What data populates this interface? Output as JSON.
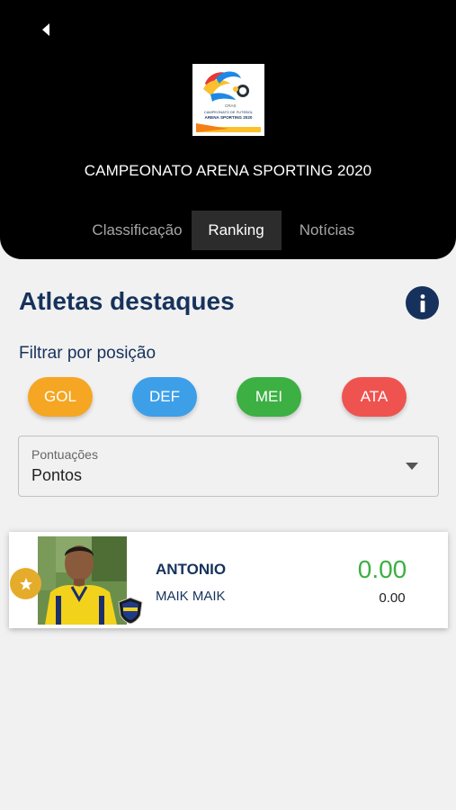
{
  "header": {
    "title": "CAMPEONATO ARENA SPORTING 2020",
    "logo": {
      "org": "CRAS",
      "line1": "CAMPEONATO DE FUTEBOL",
      "line2": "ARENA SPORTING 2020"
    },
    "tabs": [
      {
        "label": "Classificação",
        "active": false
      },
      {
        "label": "Ranking",
        "active": true
      },
      {
        "label": "Notícias",
        "active": false
      }
    ]
  },
  "main": {
    "title": "Atletas destaques",
    "filter_label": "Filtrar por posição",
    "positions": [
      {
        "label": "GOL",
        "color": "#f5a623"
      },
      {
        "label": "DEF",
        "color": "#3d9fe8"
      },
      {
        "label": "MEI",
        "color": "#3cb043"
      },
      {
        "label": "ATA",
        "color": "#ef5350"
      }
    ],
    "select": {
      "caption": "Pontuações",
      "value": "Pontos"
    },
    "athletes": [
      {
        "name": "ANTONIO",
        "team": "MAIK MAIK",
        "score": "0.00",
        "points": "0.00"
      }
    ]
  },
  "colors": {
    "primary": "#16325c",
    "score": "#3cb043",
    "star": "#e5ac2b"
  }
}
